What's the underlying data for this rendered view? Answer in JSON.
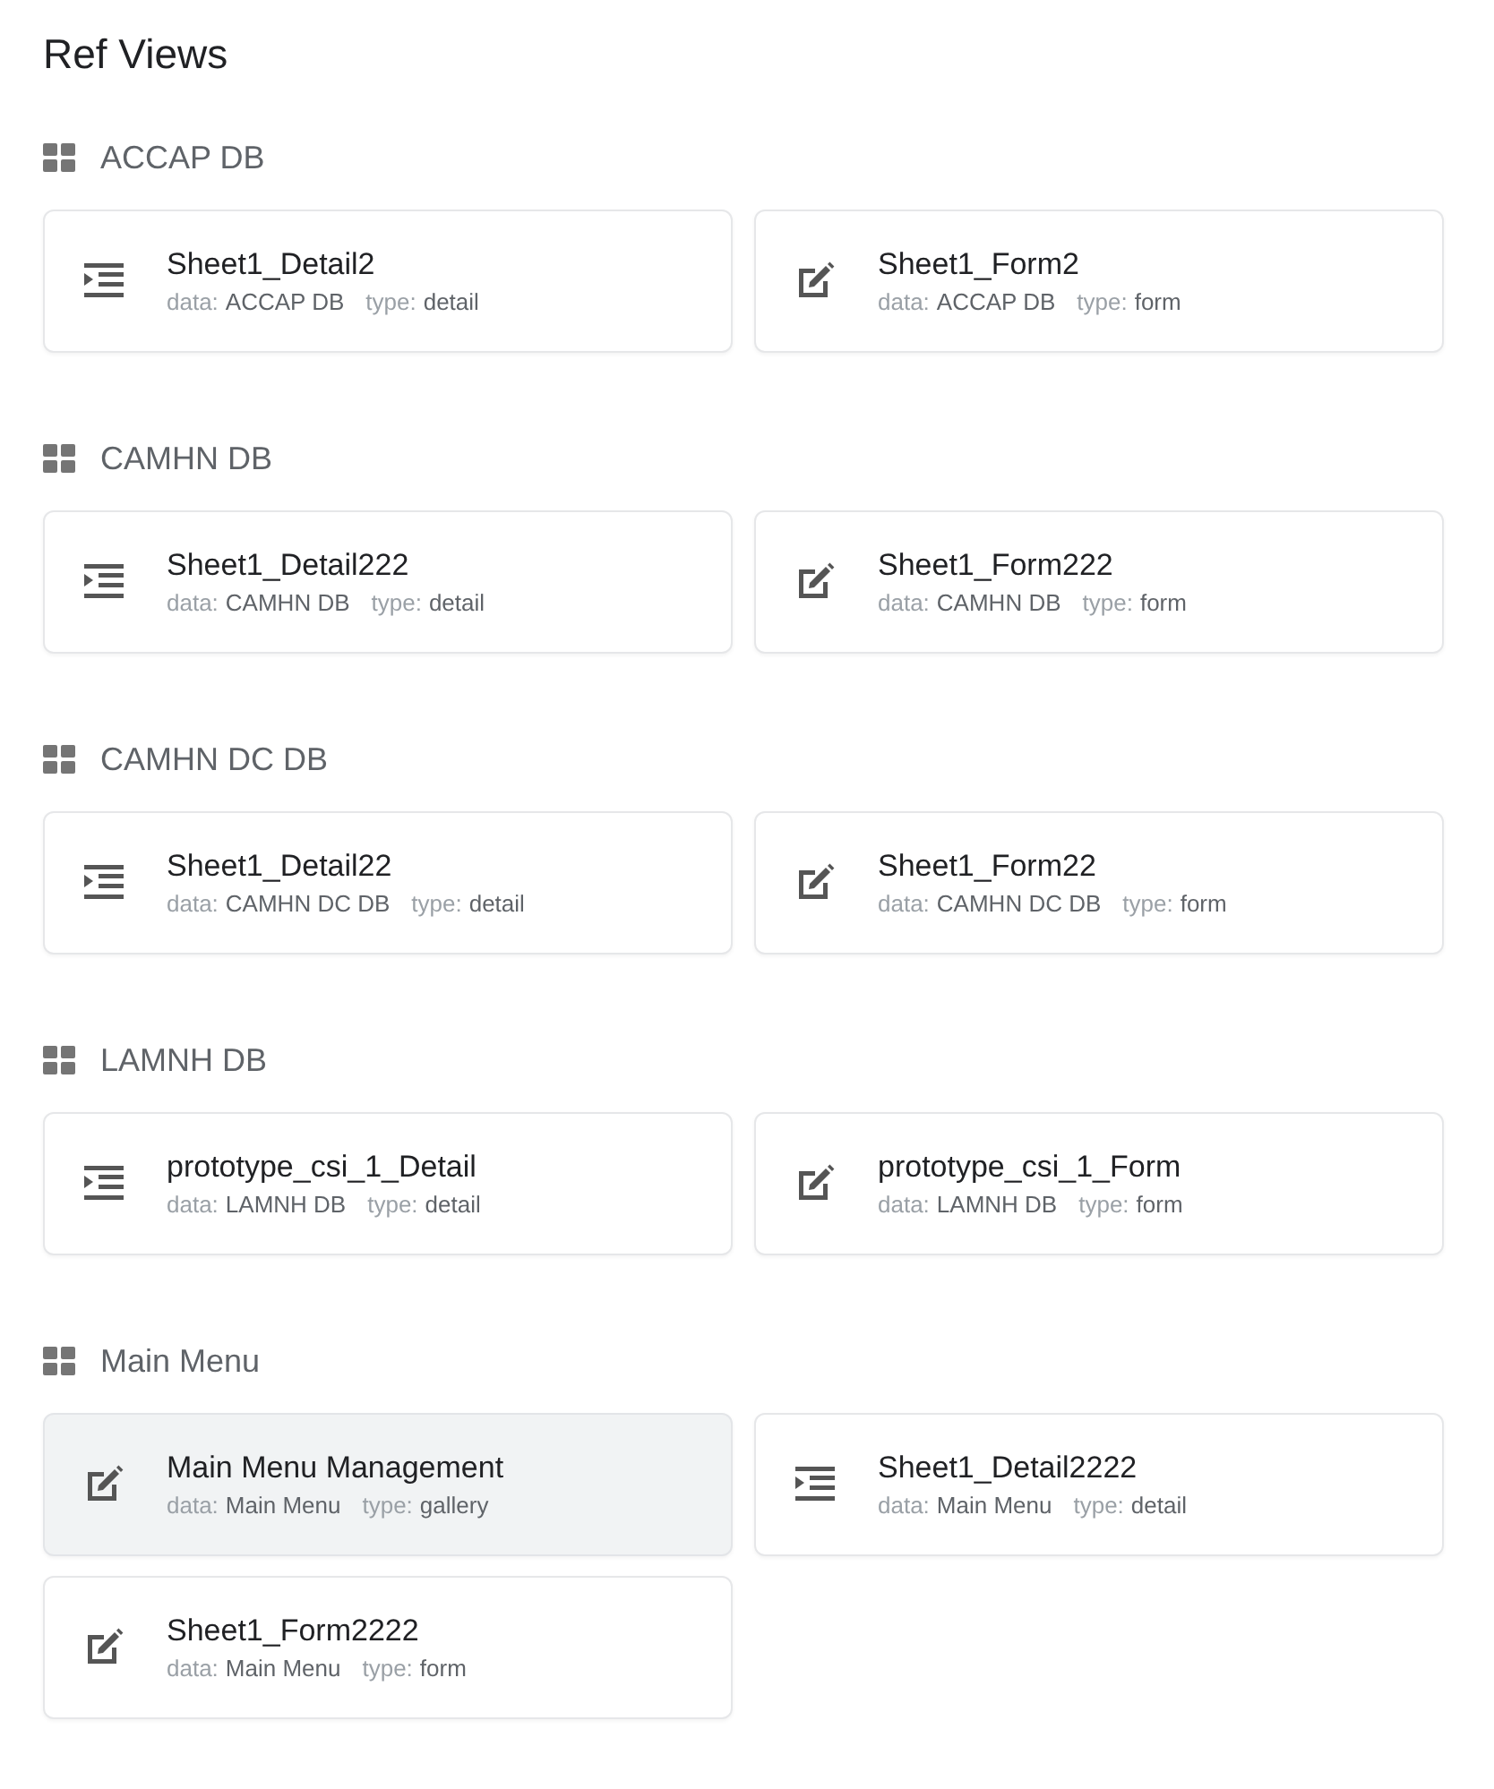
{
  "title": "Ref Views",
  "sections": [
    {
      "name": "ACCAP DB",
      "views": [
        {
          "name": "Sheet1_Detail2",
          "kind": "detail",
          "selected": false,
          "data_label": "data:",
          "data": "ACCAP DB",
          "type_label": "type:",
          "type": "detail"
        },
        {
          "name": "Sheet1_Form2",
          "kind": "form",
          "selected": false,
          "data_label": "data:",
          "data": "ACCAP DB",
          "type_label": "type:",
          "type": "form"
        }
      ]
    },
    {
      "name": "CAMHN DB",
      "views": [
        {
          "name": "Sheet1_Detail222",
          "kind": "detail",
          "selected": false,
          "data_label": "data:",
          "data": "CAMHN DB",
          "type_label": "type:",
          "type": "detail"
        },
        {
          "name": "Sheet1_Form222",
          "kind": "form",
          "selected": false,
          "data_label": "data:",
          "data": "CAMHN DB",
          "type_label": "type:",
          "type": "form"
        }
      ]
    },
    {
      "name": "CAMHN DC DB",
      "views": [
        {
          "name": "Sheet1_Detail22",
          "kind": "detail",
          "selected": false,
          "data_label": "data:",
          "data": "CAMHN DC DB",
          "type_label": "type:",
          "type": "detail"
        },
        {
          "name": "Sheet1_Form22",
          "kind": "form",
          "selected": false,
          "data_label": "data:",
          "data": "CAMHN DC DB",
          "type_label": "type:",
          "type": "form"
        }
      ]
    },
    {
      "name": "LAMNH DB",
      "views": [
        {
          "name": "prototype_csi_1_Detail",
          "kind": "detail",
          "selected": false,
          "data_label": "data:",
          "data": "LAMNH DB",
          "type_label": "type:",
          "type": "detail"
        },
        {
          "name": "prototype_csi_1_Form",
          "kind": "form",
          "selected": false,
          "data_label": "data:",
          "data": "LAMNH DB",
          "type_label": "type:",
          "type": "form"
        }
      ]
    },
    {
      "name": "Main Menu",
      "views": [
        {
          "name": "Main Menu Management",
          "kind": "form",
          "selected": true,
          "data_label": "data:",
          "data": "Main Menu",
          "type_label": "type:",
          "type": "gallery"
        },
        {
          "name": "Sheet1_Detail2222",
          "kind": "detail",
          "selected": false,
          "data_label": "data:",
          "data": "Main Menu",
          "type_label": "type:",
          "type": "detail"
        },
        {
          "name": "Sheet1_Form2222",
          "kind": "form",
          "selected": false,
          "data_label": "data:",
          "data": "Main Menu",
          "type_label": "type:",
          "type": "form"
        }
      ]
    }
  ]
}
